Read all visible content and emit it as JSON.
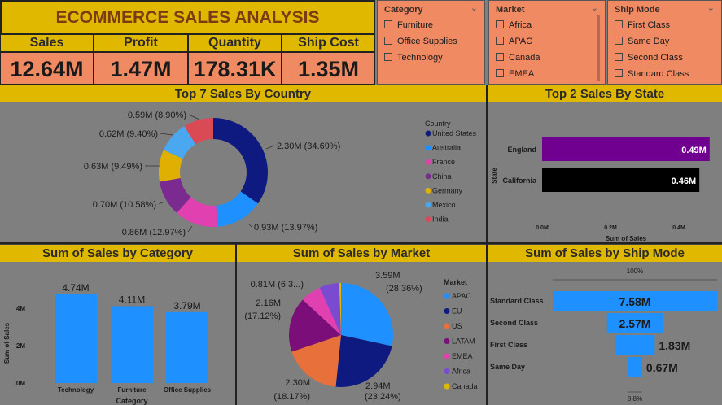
{
  "header": {
    "title": "ECOMMERCE SALES ANALYSIS"
  },
  "kpis": [
    {
      "label": "Sales",
      "value": "12.64M"
    },
    {
      "label": "Profit",
      "value": "1.47M"
    },
    {
      "label": "Quantity",
      "value": "178.31K"
    },
    {
      "label": "Ship Cost",
      "value": "1.35M"
    }
  ],
  "slicers": {
    "category": {
      "title": "Category",
      "options": [
        "Furniture",
        "Office Supplies",
        "Technology"
      ]
    },
    "market": {
      "title": "Market",
      "options": [
        "Africa",
        "APAC",
        "Canada",
        "EMEA"
      ]
    },
    "ship_mode": {
      "title": "Ship Mode",
      "options": [
        "First Class",
        "Same Day",
        "Second Class",
        "Standard Class"
      ]
    }
  },
  "icons": {
    "chevron": "chevron-down-icon",
    "checkbox": "checkbox-icon"
  },
  "colors": {
    "accent": "#e0b800",
    "kpi_bg": "#f08a62",
    "bar_blue": "#1e90ff",
    "bg": "#7f7f7f"
  },
  "chart_data": [
    {
      "type": "pie",
      "title": "Top 7 Sales By Country",
      "legend_title": "Country",
      "legend_position": "right",
      "donut": true,
      "slices": [
        {
          "label": "United States",
          "value": 2.3,
          "text": "2.30M (34.69%)",
          "color": "#0f1a80"
        },
        {
          "label": "Australia",
          "value": 0.93,
          "text": "0.93M (13.97%)",
          "color": "#1e90ff"
        },
        {
          "label": "France",
          "value": 0.86,
          "text": "0.86M (12.97%)",
          "color": "#e040b0"
        },
        {
          "label": "China",
          "value": 0.7,
          "text": "0.70M (10.58%)",
          "color": "#7b2a90"
        },
        {
          "label": "Germany",
          "value": 0.63,
          "text": "0.63M (9.49%)",
          "color": "#e0b000"
        },
        {
          "label": "Mexico",
          "value": 0.62,
          "text": "0.62M (9.40%)",
          "color": "#4aa8f0"
        },
        {
          "label": "India",
          "value": 0.59,
          "text": "0.59M (8.90%)",
          "color": "#d94a55"
        }
      ]
    },
    {
      "type": "bar",
      "orientation": "horizontal",
      "title": "Top 2 Sales By State",
      "xlabel": "Sum of Sales",
      "ylabel": "State",
      "categories": [
        "England",
        "California"
      ],
      "values": [
        0.49,
        0.46
      ],
      "value_labels": [
        "0.49M",
        "0.46M"
      ],
      "bar_colors": [
        "#700090",
        "#000000"
      ],
      "xlim": [
        0,
        0.5
      ],
      "xticks": [
        "0.0M",
        "0.2M",
        "0.4M"
      ],
      "xtick_values": [
        0,
        0.2,
        0.4
      ]
    },
    {
      "type": "bar",
      "title": "Sum of Sales by Category",
      "xlabel": "Category",
      "ylabel": "Sum of Sales",
      "categories": [
        "Technology",
        "Furniture",
        "Office Supplies"
      ],
      "values": [
        4.74,
        4.11,
        3.79
      ],
      "value_labels": [
        "4.74M",
        "4.11M",
        "3.79M"
      ],
      "ylim": [
        0,
        5
      ],
      "yticks": [
        "0M",
        "2M",
        "4M"
      ],
      "ytick_values": [
        0,
        2,
        4
      ]
    },
    {
      "type": "pie",
      "title": "Sum of Sales by Market",
      "legend_title": "Market",
      "legend_position": "right",
      "slices": [
        {
          "label": "APAC",
          "value": 3.59,
          "text": "3.59M (28.36%)",
          "color": "#1e90ff"
        },
        {
          "label": "EU",
          "value": 2.94,
          "text": "2.94M (23.24%)",
          "color": "#0f1a80"
        },
        {
          "label": "US",
          "value": 2.3,
          "text": "2.30M (18.17%)",
          "color": "#e8703a"
        },
        {
          "label": "LATAM",
          "value": 2.16,
          "text": "2.16M (17.12%)",
          "color": "#7b0e78"
        },
        {
          "label": "EMEA",
          "value": 0.81,
          "text": "0.81M (6.3...)",
          "color": "#e040b0"
        },
        {
          "label": "Africa",
          "value": 0.78,
          "text": "",
          "color": "#7a4ad0"
        },
        {
          "label": "Canada",
          "value": 0.07,
          "text": "",
          "color": "#e0b800"
        }
      ]
    },
    {
      "type": "bar",
      "subtype": "funnel",
      "title": "Sum of Sales by Ship Mode",
      "categories": [
        "Standard Class",
        "Second Class",
        "First Class",
        "Same Day"
      ],
      "values": [
        7.58,
        2.57,
        1.83,
        0.67
      ],
      "value_labels": [
        "7.58M",
        "2.57M",
        "1.83M",
        "0.67M"
      ],
      "top_label": "100%",
      "bottom_label": "8.8%"
    }
  ]
}
